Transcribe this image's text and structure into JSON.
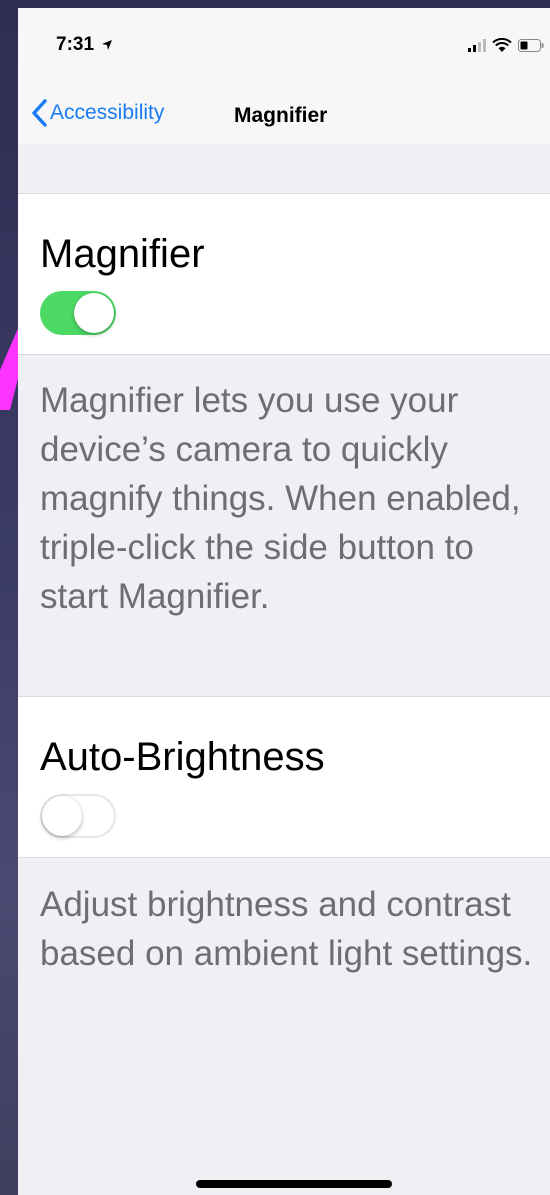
{
  "status_bar": {
    "time": "7:31"
  },
  "nav": {
    "back_label": "Accessibility",
    "title": "Magnifier"
  },
  "magnifier": {
    "title": "Magnifier",
    "toggle_on": true,
    "description": "Magnifier lets you use your device’s camera to quickly magnify things. When enabled, triple-click the side button to start Magnifier."
  },
  "auto_brightness": {
    "title": "Auto-Brightness",
    "toggle_on": false,
    "description": "Adjust brightness and contrast based on ambient light settings."
  },
  "colors": {
    "accent": "#1a7cf5",
    "toggle_on": "#4cd964",
    "background": "#efeff4",
    "annotation": "#ff33ff"
  }
}
